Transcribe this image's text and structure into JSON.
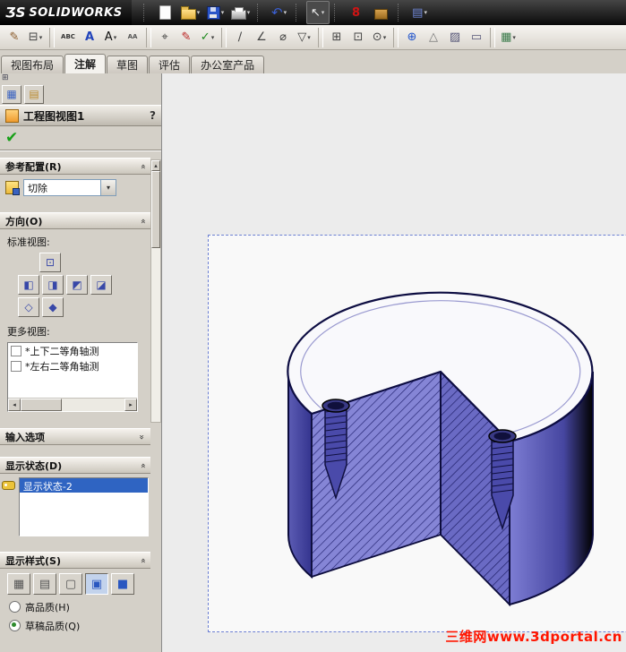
{
  "window": {
    "logo_mark": "ƷS",
    "logo_text": "SOLIDWORKS"
  },
  "ui": {
    "caret": "▾",
    "chevron": "«",
    "arrow_up": "▴",
    "arrow_down": "▾",
    "arrow_left": "◂",
    "arrow_right": "▸"
  },
  "toolbar_main": {
    "icons": [
      {
        "name": "new-document-icon"
      },
      {
        "name": "open-folder-icon"
      },
      {
        "name": "save-icon"
      },
      {
        "name": "print-icon"
      },
      {
        "name": "undo-icon",
        "glyph": "↶"
      },
      {
        "name": "select-cursor-icon",
        "glyph": "↖"
      },
      {
        "name": "instant3d-icon",
        "glyph": "8"
      },
      {
        "name": "toolbox-icon"
      },
      {
        "name": "options-list-icon",
        "glyph": "▤"
      }
    ]
  },
  "toolbar_annotation": {
    "icons": [
      {
        "name": "smart-dimension-icon",
        "glyph": "✎",
        "color": "#8a5a2a"
      },
      {
        "name": "model-items-icon",
        "glyph": "⊟",
        "color": "#444444"
      },
      {
        "name": "spell-checker-icon",
        "glyph": "ABC",
        "color": "#333333"
      },
      {
        "name": "format-painter-icon",
        "glyph": "A",
        "color": "#2244bb"
      },
      {
        "name": "note-icon",
        "glyph": "A",
        "color": "#111111"
      },
      {
        "name": "linear-note-pattern-icon",
        "glyph": "AA",
        "color": "#555555"
      },
      {
        "name": "zoom-to-area-icon",
        "glyph": "⌖",
        "color": "#444444"
      },
      {
        "name": "revision-symbol-icon",
        "glyph": "✎",
        "color": "#bb2222"
      },
      {
        "name": "design-checker-icon",
        "glyph": "✓",
        "color": "#1d8a1d"
      },
      {
        "name": "ordinate-dimension-icon",
        "glyph": "∕",
        "color": "#444444"
      },
      {
        "name": "angle-dimension-icon",
        "glyph": "∠",
        "color": "#444444"
      },
      {
        "name": "hole-callout-icon",
        "glyph": "⌀",
        "color": "#444444"
      },
      {
        "name": "datum-feature-icon",
        "glyph": "▽",
        "color": "#444444"
      },
      {
        "name": "model-view-icon",
        "glyph": "⊞",
        "color": "#444444"
      },
      {
        "name": "section-view-icon",
        "glyph": "⊡",
        "color": "#444444"
      },
      {
        "name": "magnifier-icon",
        "glyph": "⊙",
        "color": "#444444"
      },
      {
        "name": "origin-icon",
        "glyph": "⊕",
        "color": "#2255cc"
      },
      {
        "name": "draft-quality-icon",
        "glyph": "△",
        "color": "#777777"
      },
      {
        "name": "area-hatch-icon",
        "glyph": "▨",
        "color": "#555577"
      },
      {
        "name": "block-icon",
        "glyph": "▭",
        "color": "#555577"
      },
      {
        "name": "tables-icon",
        "glyph": "▦",
        "color": "#3a7a4a"
      }
    ]
  },
  "tabs": {
    "items": [
      {
        "label": "视图布局"
      },
      {
        "label": "注解"
      },
      {
        "label": "草图"
      },
      {
        "label": "评估"
      },
      {
        "label": "办公室产品"
      }
    ]
  },
  "property_panel": {
    "pin_glyph": "⊞",
    "pm_tabs": [
      {
        "name": "properties-tab-icon",
        "glyph": "▦",
        "color": "#3a62c0"
      },
      {
        "name": "sheet-tab-icon",
        "glyph": "▤",
        "color": "#b9882a"
      }
    ],
    "title": "工程图视图1",
    "help": "?",
    "ok_glyph": "✔",
    "reference_config": {
      "header": "参考配置(R)",
      "value": "切除"
    },
    "orientation": {
      "header": "方向(O)",
      "standard_label": "标准视图:",
      "more_label": "更多视图:",
      "views": [
        {
          "name": "view-front-button",
          "glyph": "⊡"
        },
        {
          "name": "view-back-button",
          "glyph": "◧"
        },
        {
          "name": "view-left-button",
          "glyph": "◨"
        },
        {
          "name": "view-right-button",
          "glyph": "◩"
        },
        {
          "name": "view-top-button",
          "glyph": "◪"
        },
        {
          "name": "view-isometric-button",
          "glyph": "◇"
        },
        {
          "name": "view-dimetric-button",
          "glyph": "◆"
        }
      ],
      "more_views": [
        {
          "label": "*上下二等角轴测"
        },
        {
          "label": "*左右二等角轴测"
        }
      ]
    },
    "import_options": {
      "header": "输入选项"
    },
    "display_state": {
      "header": "显示状态(D)",
      "items": [
        {
          "label": "显示状态-2",
          "selected": true
        }
      ]
    },
    "display_style": {
      "header": "显示样式(S)",
      "styles": [
        {
          "name": "wireframe-style-button",
          "glyph": "▦",
          "color": "#555555"
        },
        {
          "name": "hidden-lines-visible-style-button",
          "glyph": "▤",
          "color": "#555555"
        },
        {
          "name": "hidden-lines-removed-style-button",
          "glyph": "▢",
          "color": "#555555"
        },
        {
          "name": "shaded-with-edges-style-button",
          "glyph": "▣",
          "color": "#2a57c0",
          "pressed": true
        },
        {
          "name": "shaded-style-button",
          "glyph": "■",
          "color": "#2a57c0"
        }
      ],
      "high_quality": "高品质(H)",
      "draft_quality": "草稿品质(Q)"
    }
  },
  "sheet": {
    "watermark": "三维网www.3dportal.cn"
  },
  "colors": {
    "part_blue": "#5d5dbd",
    "hatch_line": "#20206e",
    "selection_blue": "#2f64c2",
    "sheet_border": "#6a7ed2",
    "watermark_red": "#ff1500"
  }
}
